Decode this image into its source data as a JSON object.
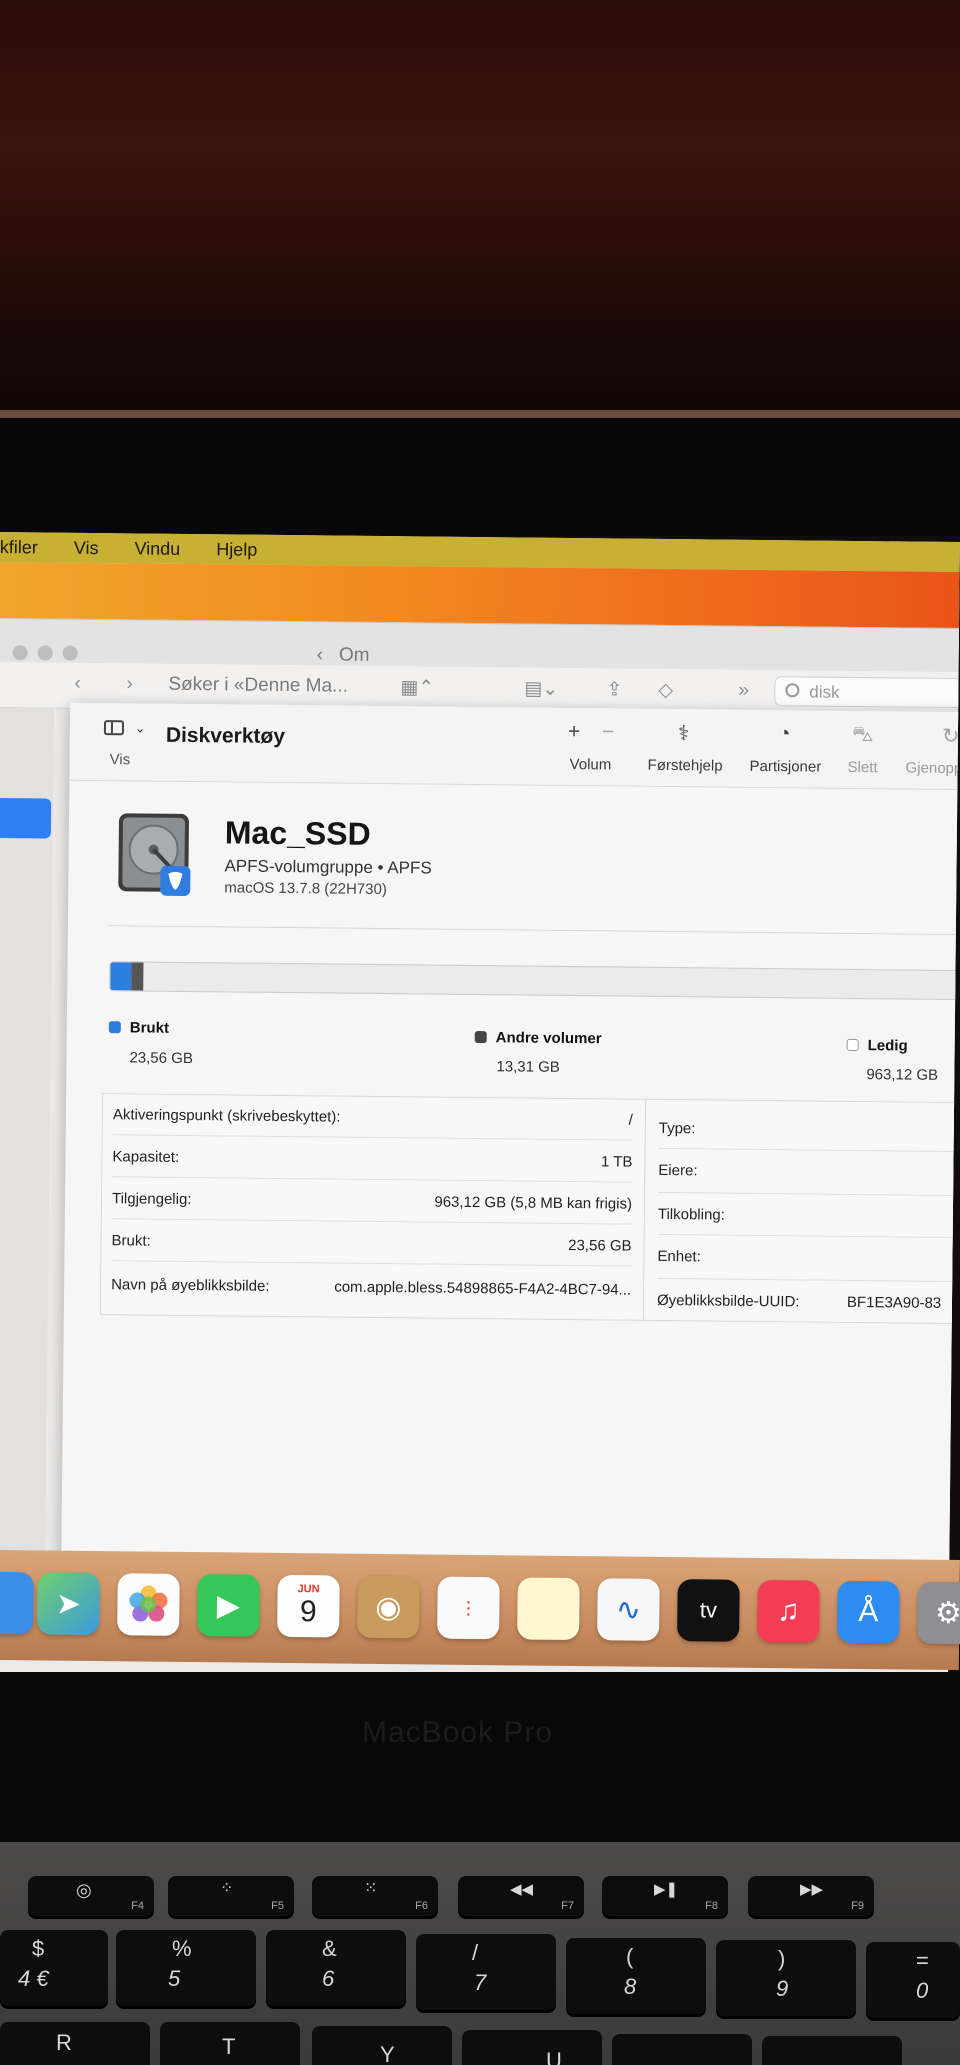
{
  "menubar": {
    "items": [
      "kfiler",
      "Vis",
      "Vindu",
      "Hjelp"
    ]
  },
  "behind_window": {
    "title": "Om"
  },
  "finder_toolbar": {
    "path": "Søker i «Denne Ma...",
    "search": "disk"
  },
  "disk_utility": {
    "title": "Diskverktøy",
    "sidebar_label": "Vis",
    "toolbar": {
      "volum": "Volum",
      "forstehjelp": "Førstehjelp",
      "partisjoner": "Partisjoner",
      "slett": "Slett",
      "gjenopp": "Gjenopp"
    },
    "volume": {
      "name": "Mac_SSD",
      "subtitle": "APFS-volumgruppe • APFS",
      "os": "macOS 13.7.8 (22H730)"
    },
    "usage": {
      "used_label": "Brukt",
      "used_value": "23,56 GB",
      "other_label": "Andre volumer",
      "other_value": "13,31 GB",
      "free_label": "Ledig",
      "free_value": "963,12 GB",
      "used_fraction": 0.0236,
      "other_fraction": 0.0133,
      "colors": {
        "used": "#2d7fdf",
        "other": "#555555",
        "free": "#ebebeb"
      }
    },
    "info_left": [
      {
        "k": "Aktiveringspunkt (skrivebeskyttet):",
        "v": "/"
      },
      {
        "k": "Kapasitet:",
        "v": "1 TB"
      },
      {
        "k": "Tilgjengelig:",
        "v": "963,12 GB (5,8 MB kan frigis)"
      },
      {
        "k": "Brukt:",
        "v": "23,56 GB"
      },
      {
        "k": "Navn på øyeblikksbilde:",
        "v": "com.apple.bless.54898865-F4A2-4BC7-94..."
      }
    ],
    "info_right": [
      {
        "k": "Type:",
        "v": ""
      },
      {
        "k": "Eiere:",
        "v": ""
      },
      {
        "k": "Tilkobling:",
        "v": ""
      },
      {
        "k": "Enhet:",
        "v": ""
      },
      {
        "k": "Øyeblikksbilde-UUID:",
        "v": "BF1E3A90-83"
      }
    ]
  },
  "dock": {
    "calendar_month": "JUN",
    "calendar_day": "9",
    "tv_label": "tv"
  },
  "laptop": {
    "brand": "MacBook Pro"
  },
  "keyboard": {
    "fn_row": [
      "F4",
      "F5",
      "F6",
      "F7",
      "F8",
      "F9"
    ],
    "num_row": [
      {
        "top": "$",
        "bottom": "4 €"
      },
      {
        "top": "%",
        "bottom": "5"
      },
      {
        "top": "&",
        "bottom": "6"
      },
      {
        "top": "/",
        "bottom": "7"
      },
      {
        "top": "(",
        "bottom": "8"
      },
      {
        "top": ")",
        "bottom": "9"
      },
      {
        "top": "=",
        "bottom": "0"
      }
    ],
    "letter_row": [
      "R",
      "T",
      "Y",
      "U"
    ]
  }
}
